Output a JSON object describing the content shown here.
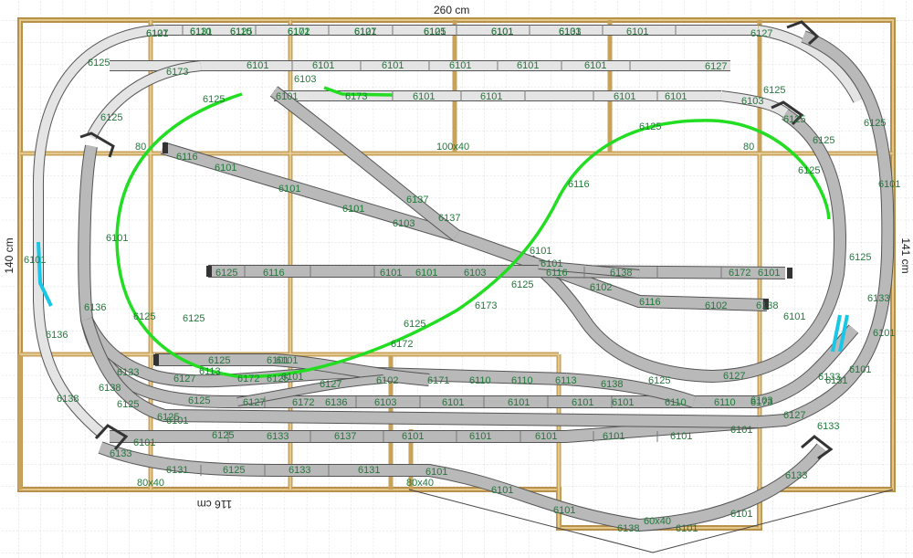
{
  "dimensions": {
    "top": "260 cm",
    "left": "140 cm",
    "right": "141 cm",
    "bottom": "116 cm"
  },
  "boards": [
    "100x40",
    "80",
    "80",
    "80x40",
    "80x40",
    "60x40"
  ],
  "colors": {
    "frame": "#c8a25a",
    "track": "#b9b9b9",
    "track_light": "#e4e4e4",
    "track_edge": "#555555",
    "label": "#1f7a3a",
    "upper_loop": "#22dd22",
    "uncoupler": "#19c6e6",
    "grid": "#d8d8d8"
  },
  "labels": [
    "6127",
    "6110",
    "6110",
    "6101",
    "6101",
    "6101",
    "6101",
    "6101",
    "6101",
    "6127",
    "6125",
    "6173",
    "6101",
    "6101",
    "6101",
    "6101",
    "6101",
    "6101",
    "6127",
    "6125",
    "6103",
    "6101",
    "6173",
    "6101",
    "6101",
    "6101",
    "6101",
    "6103",
    "6125",
    "6125",
    "6125",
    "6125",
    "6101",
    "6125",
    "6125",
    "6116",
    "6101",
    "6101",
    "6101",
    "6103",
    "6137",
    "6137",
    "6101",
    "6125",
    "6125",
    "6125",
    "6125",
    "6116",
    "6101",
    "6101",
    "6103",
    "6116",
    "6138",
    "6172",
    "6101",
    "6102",
    "6116",
    "6102",
    "6138",
    "6101",
    "6116",
    "6173",
    "6125",
    "6101",
    "6172",
    "6127",
    "6136",
    "6133",
    "6125",
    "6101",
    "6101",
    "6113",
    "6125",
    "6127",
    "6138",
    "6125",
    "6125",
    "6125",
    "6102",
    "6171",
    "6110",
    "6110",
    "6113",
    "6138",
    "6125",
    "6127",
    "6172",
    "6136",
    "6103",
    "6101",
    "6101",
    "6101",
    "6101",
    "6110",
    "6110",
    "6173",
    "6103",
    "6127",
    "6125",
    "6133",
    "6137",
    "6101",
    "6101",
    "6101",
    "6101",
    "6101",
    "6101",
    "6101",
    "6101",
    "6131",
    "6133",
    "6131",
    "6125",
    "6133",
    "6131",
    "6101",
    "6101",
    "6101",
    "6138",
    "6101",
    "6101",
    "6133",
    "6133",
    "6133",
    "6133",
    "6101",
    "6101",
    "6127",
    "6125",
    "6125",
    "6136",
    "6138",
    "6172",
    "6101",
    "6101",
    "6101",
    "6101",
    "6131",
    "6125",
    "6172",
    "6127",
    "6125",
    "6101",
    "6133"
  ]
}
